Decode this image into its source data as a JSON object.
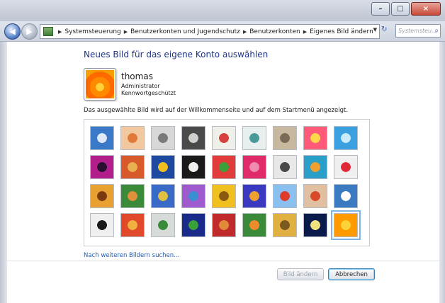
{
  "window": {
    "minimize_glyph": "–",
    "maximize_glyph": "□",
    "close_glyph": "×"
  },
  "nav": {
    "back_glyph": "◀",
    "forward_glyph": "▶"
  },
  "breadcrumbs": [
    "Systemsteuerung",
    "Benutzerkonten und Jugendschutz",
    "Benutzerkonten",
    "Eigenes Bild ändern"
  ],
  "search": {
    "placeholder": "Systemsteu..."
  },
  "heading": "Neues Bild für das eigene Konto auswählen",
  "user": {
    "name": "thomas",
    "role": "Administrator",
    "status": "Kennwortgeschützt"
  },
  "description": "Das ausgewählte Bild wird auf der Willkommenseite und auf dem Startmenü angezeigt.",
  "pictures": [
    {
      "icon": "ferris-wheel",
      "c1": "#3a78c8",
      "c2": "#dfe9f8"
    },
    {
      "icon": "starfish",
      "c1": "#f2c8a0",
      "c2": "#e07a3a"
    },
    {
      "icon": "robot",
      "c1": "#d8d8d8",
      "c2": "#7a7a7a"
    },
    {
      "icon": "record-player",
      "c1": "#4a4a4a",
      "c2": "#d0d0d0"
    },
    {
      "icon": "lucky-cat",
      "c1": "#f0f0ea",
      "c2": "#d84040"
    },
    {
      "icon": "globe",
      "c1": "#e8f0ef",
      "c2": "#4a9a9a"
    },
    {
      "icon": "kitten",
      "c1": "#c8b8a0",
      "c2": "#7a6a58"
    },
    {
      "icon": "red-flower",
      "c1": "#ff5a78",
      "c2": "#ffd84a"
    },
    {
      "icon": "pinwheel",
      "c1": "#3aa0e0",
      "c2": "#c8ecfa"
    },
    {
      "icon": "purple-ball",
      "c1": "#b21f8a",
      "c2": "#2a1030"
    },
    {
      "icon": "textile",
      "c1": "#d85a2a",
      "c2": "#e8b050"
    },
    {
      "icon": "yellow-leaf",
      "c1": "#1d4aa0",
      "c2": "#f0c020"
    },
    {
      "icon": "dog",
      "c1": "#1a1a1a",
      "c2": "#f0f0f0"
    },
    {
      "icon": "crayons",
      "c1": "#e03a3a",
      "c2": "#3aa03a"
    },
    {
      "icon": "pink-leaf",
      "c1": "#e02a6a",
      "c2": "#f08ab0"
    },
    {
      "icon": "jacks",
      "c1": "#e8e8e8",
      "c2": "#4a4a4a"
    },
    {
      "icon": "stairs",
      "c1": "#2aa0c8",
      "c2": "#f0a030"
    },
    {
      "icon": "paper-crane",
      "c1": "#f0f0f0",
      "c2": "#e02a3a"
    },
    {
      "icon": "guitar",
      "c1": "#e8a030",
      "c2": "#7a3a10"
    },
    {
      "icon": "puppy",
      "c1": "#3a8a3a",
      "c2": "#e0903a"
    },
    {
      "icon": "toy-robot",
      "c1": "#3a6ac8",
      "c2": "#e0c040"
    },
    {
      "icon": "fabric",
      "c1": "#a05ad0",
      "c2": "#3a90d0"
    },
    {
      "icon": "sunflower",
      "c1": "#f0c020",
      "c2": "#8a5a10"
    },
    {
      "icon": "butterfly",
      "c1": "#3a3ac0",
      "c2": "#f0a030"
    },
    {
      "icon": "hot-air-balloon",
      "c1": "#8ac0f0",
      "c2": "#e03a2a"
    },
    {
      "icon": "doll",
      "c1": "#e0c0a0",
      "c2": "#d84a2a"
    },
    {
      "icon": "sailboat",
      "c1": "#3a7ac0",
      "c2": "#ffffff"
    },
    {
      "icon": "soccer-ball",
      "c1": "#f0f0f0",
      "c2": "#1a1a1a"
    },
    {
      "icon": "striped-cloth",
      "c1": "#e04a2a",
      "c2": "#f0b040"
    },
    {
      "icon": "marbles",
      "c1": "#d8dcd8",
      "c2": "#3a8a3a"
    },
    {
      "icon": "window",
      "c1": "#1a2a8a",
      "c2": "#3aa03a"
    },
    {
      "icon": "scarf",
      "c1": "#c02a2a",
      "c2": "#e08a3a"
    },
    {
      "icon": "monarch-butterfly",
      "c1": "#3a8a3a",
      "c2": "#f08a2a"
    },
    {
      "icon": "spiral-shell",
      "c1": "#e0b040",
      "c2": "#7a5a20"
    },
    {
      "icon": "lantern",
      "c1": "#0a1a4a",
      "c2": "#f0e080"
    },
    {
      "icon": "orange-flower",
      "c1": "#ff9a00",
      "c2": "#ffd23a"
    }
  ],
  "selected_index": 35,
  "more_link": "Nach weiteren Bildern suchen...",
  "buttons": {
    "change": "Bild ändern",
    "cancel": "Abbrechen"
  }
}
